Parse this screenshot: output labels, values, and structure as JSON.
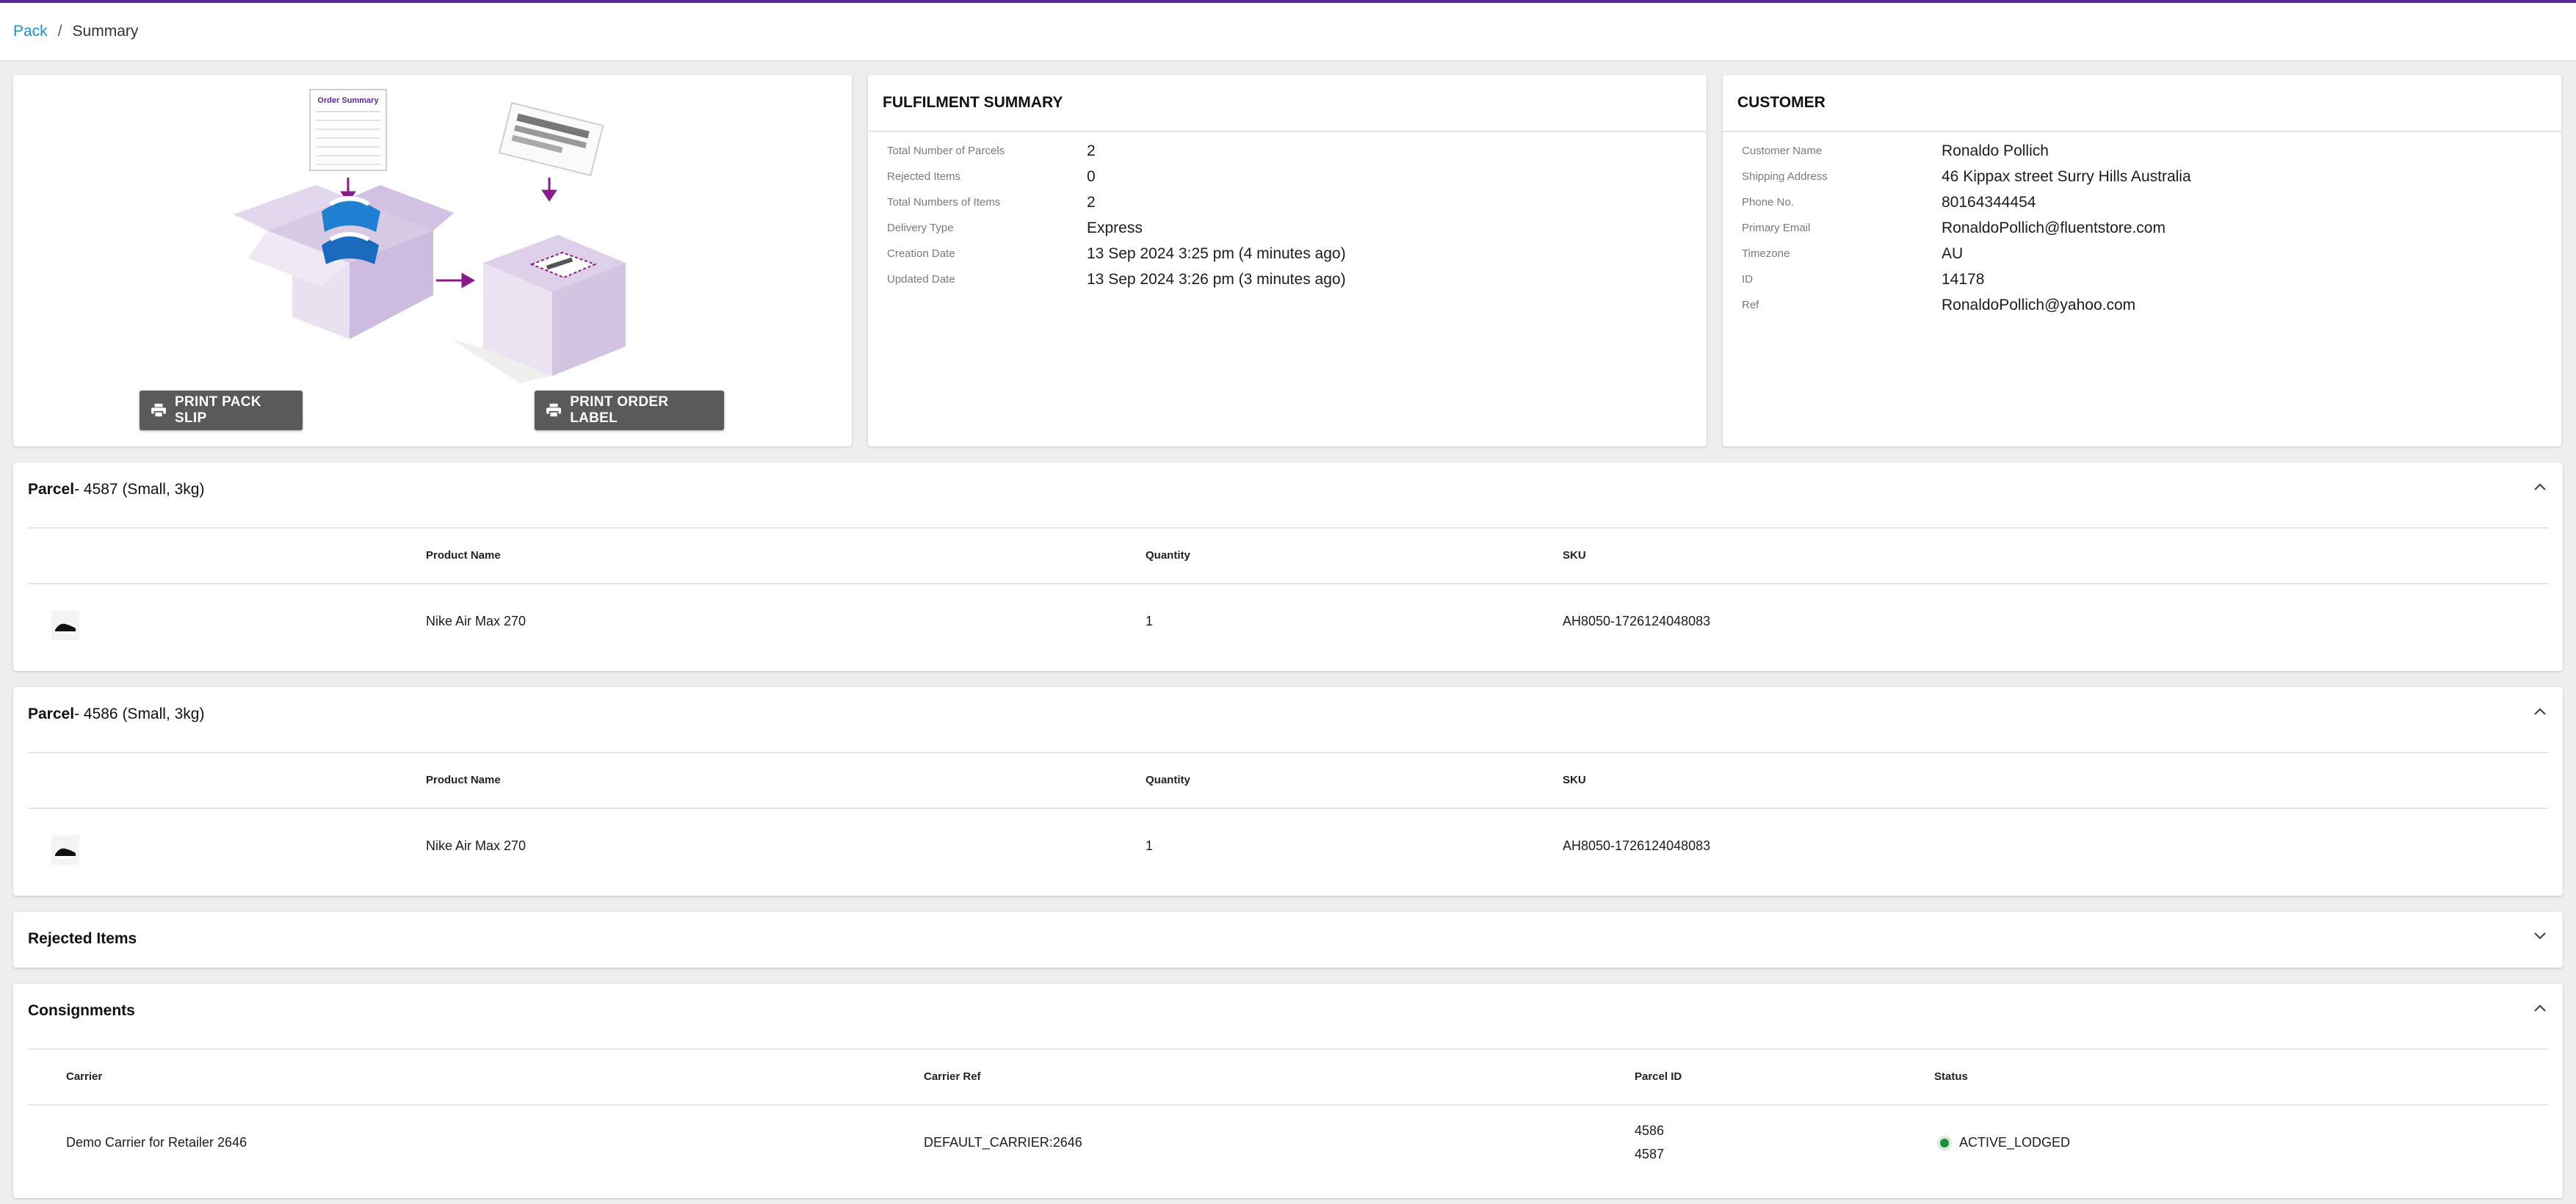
{
  "breadcrumb": {
    "parent": "Pack",
    "separator": "/",
    "current": "Summary"
  },
  "illustration": {
    "doc_title": "Order Summary"
  },
  "actions": {
    "print_pack_slip": "PRINT PACK SLIP",
    "print_order_label": "PRINT ORDER LABEL"
  },
  "fulfilment": {
    "title": "FULFILMENT SUMMARY",
    "rows": [
      {
        "label": "Total Number of Parcels",
        "value": "2"
      },
      {
        "label": "Rejected Items",
        "value": "0"
      },
      {
        "label": "Total Numbers of Items",
        "value": "2"
      },
      {
        "label": "Delivery Type",
        "value": "Express"
      },
      {
        "label": "Creation Date",
        "value": "13 Sep 2024 3:25 pm (4 minutes ago)"
      },
      {
        "label": "Updated Date",
        "value": "13 Sep 2024 3:26 pm (3 minutes ago)"
      }
    ]
  },
  "customer": {
    "title": "CUSTOMER",
    "rows": [
      {
        "label": "Customer Name",
        "value": "Ronaldo Pollich"
      },
      {
        "label": "Shipping Address",
        "value": "46 Kippax street Surry Hills Australia"
      },
      {
        "label": "Phone No.",
        "value": "80164344454"
      },
      {
        "label": "Primary Email",
        "value": "RonaldoPollich@fluentstore.com"
      },
      {
        "label": "Timezone",
        "value": "AU"
      },
      {
        "label": "ID",
        "value": "14178"
      },
      {
        "label": "Ref",
        "value": "RonaldoPollich@yahoo.com"
      }
    ]
  },
  "parcels": [
    {
      "label": "Parcel",
      "detail": " - 4587 (Small, 3kg)",
      "columns": [
        "Product Name",
        "Quantity",
        "SKU"
      ],
      "items": [
        {
          "product": "Nike Air Max 270",
          "quantity": "1",
          "sku": "AH8050-1726124048083"
        }
      ]
    },
    {
      "label": "Parcel",
      "detail": " - 4586 (Small, 3kg)",
      "columns": [
        "Product Name",
        "Quantity",
        "SKU"
      ],
      "items": [
        {
          "product": "Nike Air Max 270",
          "quantity": "1",
          "sku": "AH8050-1726124048083"
        }
      ]
    }
  ],
  "rejected": {
    "title": "Rejected Items"
  },
  "consignments": {
    "title": "Consignments",
    "columns": [
      "Carrier",
      "Carrier Ref",
      "Parcel ID",
      "Status"
    ],
    "rows": [
      {
        "carrier": "Demo Carrier for Retailer 2646",
        "carrier_ref": "DEFAULT_CARRIER:2646",
        "parcel_ids": [
          "4586",
          "4587"
        ],
        "status": "ACTIVE_LODGED",
        "status_color": "#1e8e3e"
      }
    ]
  },
  "colors": {
    "accent": "#5b2a9d",
    "link": "#1a90c8",
    "button": "#5a5a5a"
  },
  "icons": [
    "printer-icon",
    "chevron-up-icon",
    "chevron-down-icon",
    "shoe-thumbnail"
  ]
}
